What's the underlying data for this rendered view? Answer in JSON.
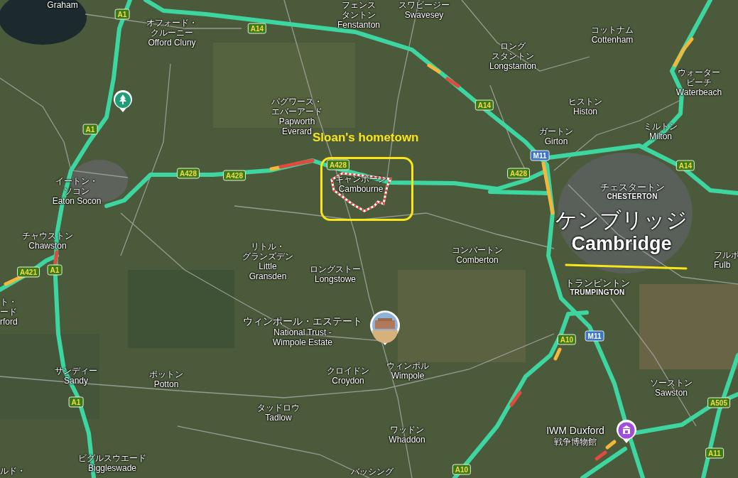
{
  "places": [
    {
      "kind": "village",
      "lines": [
        "Graham"
      ]
    },
    {
      "kind": "village",
      "lines": [
        "オフォード・",
        "クルーニー",
        "Offord Cluny"
      ]
    },
    {
      "kind": "village",
      "lines": [
        "フェンス",
        "タントン",
        "Fenstanton"
      ]
    },
    {
      "kind": "village",
      "lines": [
        "スワビージー",
        "Swavesey"
      ]
    },
    {
      "kind": "village",
      "lines": [
        "ロング",
        "スタントン",
        "Longstanton"
      ]
    },
    {
      "kind": "village",
      "lines": [
        "コットナム",
        "Cottenham"
      ]
    },
    {
      "kind": "village",
      "lines": [
        "ウォーター",
        "ビーチ",
        "Waterbeach"
      ]
    },
    {
      "kind": "village",
      "lines": [
        "パグワース・",
        "エバーアード",
        "Papworth",
        "Everard"
      ]
    },
    {
      "kind": "village",
      "lines": [
        "ヒストン",
        "Histon"
      ]
    },
    {
      "kind": "village",
      "lines": [
        "ガートン",
        "Girton"
      ]
    },
    {
      "kind": "village",
      "lines": [
        "ミルトン",
        "Milton"
      ]
    },
    {
      "kind": "district",
      "lines": [
        "チェスタートン",
        "CHESTERTON"
      ]
    },
    {
      "kind": "city",
      "lines": [
        "ケンブリッジ",
        "Cambridge"
      ]
    },
    {
      "kind": "village",
      "lines": [
        "イートン・",
        "ソコン",
        "Eaton Socon"
      ]
    },
    {
      "kind": "village",
      "lines": [
        "キャンボーン",
        "Cambourne"
      ]
    },
    {
      "kind": "village",
      "lines": [
        "チャウストン",
        "Chawston"
      ]
    },
    {
      "kind": "village",
      "lines": [
        "ト・",
        "ード",
        "rford"
      ]
    },
    {
      "kind": "village",
      "lines": [
        "リトル・",
        "グランズデン",
        "Little",
        "Gransden"
      ]
    },
    {
      "kind": "village",
      "lines": [
        "ロングストー",
        "Longstowe"
      ]
    },
    {
      "kind": "village",
      "lines": [
        "コンバートン",
        "Comberton"
      ]
    },
    {
      "kind": "village",
      "lines": [
        "フルボ",
        "Fulb"
      ]
    },
    {
      "kind": "district",
      "lines": [
        "トランピントン",
        "TRUMPINGTON"
      ]
    },
    {
      "kind": "poi",
      "lines": [
        "ウィンポール・エステート",
        "National Trust -",
        "Wimpole Estate"
      ]
    },
    {
      "kind": "village",
      "lines": [
        "クロイドン",
        "Croydon"
      ]
    },
    {
      "kind": "village",
      "lines": [
        "ウィンポル",
        "Wimpole"
      ]
    },
    {
      "kind": "village",
      "lines": [
        "サンディー",
        "Sandy"
      ]
    },
    {
      "kind": "village",
      "lines": [
        "ポットン",
        "Potton"
      ]
    },
    {
      "kind": "village",
      "lines": [
        "ソーストン",
        "Sawston"
      ]
    },
    {
      "kind": "village",
      "lines": [
        "タッドロウ",
        "Tadlow"
      ]
    },
    {
      "kind": "village",
      "lines": [
        "ワッドン",
        "Whaddon"
      ]
    },
    {
      "kind": "poi",
      "lines": [
        "IWM Duxford",
        "戦争博物館"
      ]
    },
    {
      "kind": "village",
      "lines": [
        "ルド・"
      ]
    },
    {
      "kind": "village",
      "lines": [
        "ビグルスウエード",
        "Biggleswade"
      ]
    },
    {
      "kind": "village",
      "lines": [
        "バッシング"
      ]
    }
  ],
  "road_shields": [
    {
      "label": "A1",
      "kind": "a-road"
    },
    {
      "label": "A14",
      "kind": "a-road"
    },
    {
      "label": "A1",
      "kind": "a-road"
    },
    {
      "label": "A14",
      "kind": "a-road"
    },
    {
      "label": "A428",
      "kind": "a-road"
    },
    {
      "label": "A428",
      "kind": "a-road"
    },
    {
      "label": "A428",
      "kind": "a-road"
    },
    {
      "label": "M11",
      "kind": "motorway"
    },
    {
      "label": "A428",
      "kind": "a-road"
    },
    {
      "label": "A14",
      "kind": "a-road"
    },
    {
      "label": "A421",
      "kind": "a-road"
    },
    {
      "label": "A1",
      "kind": "a-road"
    },
    {
      "label": "A10",
      "kind": "a-road"
    },
    {
      "label": "M11",
      "kind": "motorway"
    },
    {
      "label": "A1",
      "kind": "a-road"
    },
    {
      "label": "A10",
      "kind": "a-road"
    },
    {
      "label": "A505",
      "kind": "a-road"
    },
    {
      "label": "A11",
      "kind": "a-road"
    }
  ],
  "pins": [
    {
      "kind": "park"
    },
    {
      "kind": "photo"
    },
    {
      "kind": "museum"
    }
  ],
  "annotation": {
    "text": "Sloan's hometown"
  }
}
